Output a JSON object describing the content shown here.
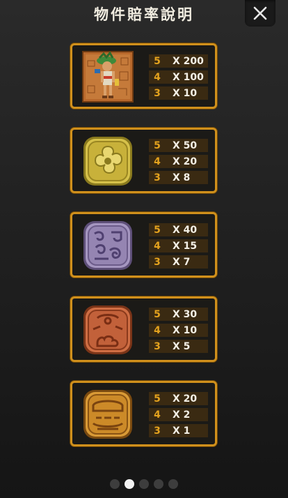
{
  "header": {
    "title": "物件賠率說明",
    "close_icon": "close-icon"
  },
  "colors": {
    "panel_border": "#d0901c",
    "count_text": "#e3a21e",
    "multiplier_text": "#f4f0e6",
    "row_background": "#3a2a12"
  },
  "symbols": [
    {
      "icon": "mayan-warrior-icon",
      "payouts": [
        {
          "count": "5",
          "multiplier": "X 200"
        },
        {
          "count": "4",
          "multiplier": "X 100"
        },
        {
          "count": "3",
          "multiplier": "X 10"
        }
      ]
    },
    {
      "icon": "gold-glyph-icon",
      "payouts": [
        {
          "count": "5",
          "multiplier": "X 50"
        },
        {
          "count": "4",
          "multiplier": "X 20"
        },
        {
          "count": "3",
          "multiplier": "X 8"
        }
      ]
    },
    {
      "icon": "purple-glyph-icon",
      "payouts": [
        {
          "count": "5",
          "multiplier": "X 40"
        },
        {
          "count": "4",
          "multiplier": "X 15"
        },
        {
          "count": "3",
          "multiplier": "X 7"
        }
      ]
    },
    {
      "icon": "red-glyph-icon",
      "payouts": [
        {
          "count": "5",
          "multiplier": "X 30"
        },
        {
          "count": "4",
          "multiplier": "X 10"
        },
        {
          "count": "3",
          "multiplier": "X 5"
        }
      ]
    },
    {
      "icon": "orange-glyph-icon",
      "payouts": [
        {
          "count": "5",
          "multiplier": "X 20"
        },
        {
          "count": "4",
          "multiplier": "X 2"
        },
        {
          "count": "3",
          "multiplier": "X 1"
        }
      ]
    }
  ],
  "pagination": {
    "total_pages": 5,
    "current_page": 2
  }
}
